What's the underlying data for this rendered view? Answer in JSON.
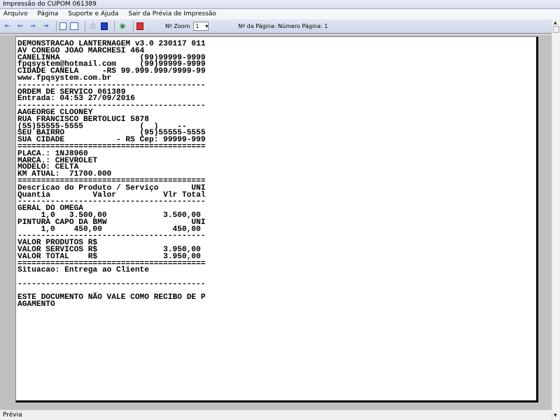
{
  "window": {
    "title": "Impressão do CUPOM 061389"
  },
  "menu": [
    "Arquivo",
    "Página",
    "Suporte e Ajuda",
    "Sair da Prévia de Impressão"
  ],
  "toolbar": {
    "zoom_label": "Nº Zoom",
    "zoom_value": "1",
    "page_label": "Nº da Página: Número Página: 1"
  },
  "receipt": {
    "lines": [
      "DEMONSTRACAO LANTERNAGEM v3.0 230117 011",
      "AV CONEGO JOAO MARCHESI 464",
      "CANELINHA                 (99)99999-9999",
      "fpqsystem@hotmail.com     (99)99999-9999",
      "CIDADE CANELA     -RS 99.999.999/9999-99",
      "www.fpqsystem.com.br",
      "----------------------------------------",
      "ORDEM DE SERVICO 061389",
      "Entrada: 04:53 27/09/2016",
      "----------------------------------------",
      "AAGEORGE CLOONEY",
      "RUA FRANCISCO BERTOLUCI 5878",
      "(55)55555-5555            (  )    --",
      "SEU BAIRRO                (95)55555-5555",
      "SUA CIDADE           - RS Cep: 99999-999",
      "========================================",
      "PLACA.: 1NJ8960",
      "MARCA.: CHEVROLET",
      "MODELO: CELTA",
      "KM ATUAL:  71700.000",
      "========================================",
      "Descricao do Produto / Serviço       UNI",
      "Quantia         Valor          Vlr Total",
      "----------------------------------------",
      "GERAL DO OMEGA",
      "     1,0   3.500,00            3.500,00",
      "PINTURA CAPO DA BMW                  UNI",
      "     1,0    450,00               450,00",
      "----------------------------------------",
      "VALOR PRODUTOS R$",
      "VALOR SERVICOS R$              3.950,00",
      "VALOR TOTAL    R$              3.950,00",
      "========================================",
      "Situacao: Entrega ao Cliente",
      "",
      "----------------------------------------",
      "",
      "ESTE DOCUMENTO NÃO VALE COMO RECIBO DE P",
      "AGAMENTO"
    ]
  },
  "status": {
    "text": "Prévia"
  }
}
